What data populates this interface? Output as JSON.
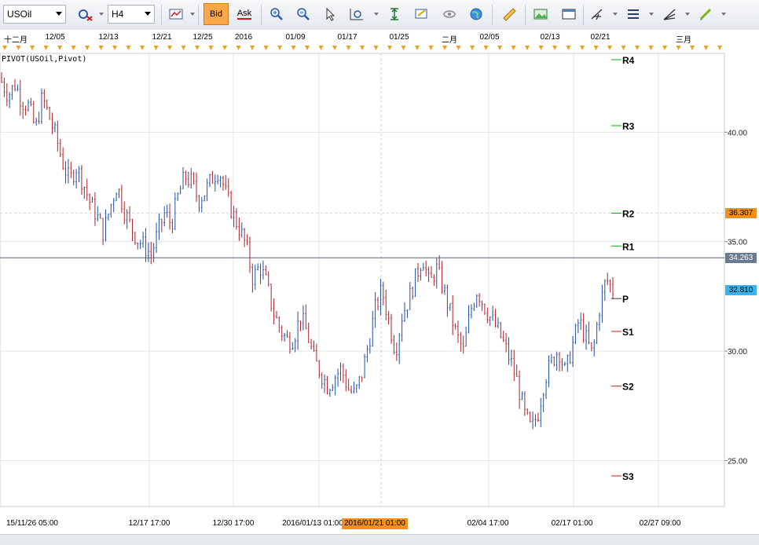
{
  "toolbar": {
    "symbol": "USOil",
    "timeframe": "H4",
    "bid_label": "Bid",
    "ask_label": "Ask"
  },
  "top_axis_labels": [
    "十二月",
    "12/05",
    "12/13",
    "12/21",
    "12/25",
    "2016",
    "01/09",
    "01/17",
    "01/25",
    "二月",
    "02/05",
    "02/13",
    "02/21",
    "三月"
  ],
  "bottom_axis_labels": [
    "15/11/26 05:00",
    "12/17 17:00",
    "12/30 17:00",
    "2016/01/13 01:00",
    "02/04 17:00",
    "02/17 01:00",
    "02/27 09:00"
  ],
  "highlighted_time": "2016/01/21 01:00",
  "indicator_label": "PIVOT(USOil,Pivot)",
  "chart_data": {
    "type": "candlestick",
    "symbol": "USOil",
    "timeframe": "H4",
    "y_ticks": [
      "40.00",
      "35.00",
      "30.00",
      "25.00"
    ],
    "ylim": [
      22.9,
      43.6
    ],
    "pivots": [
      {
        "name": "R4",
        "value": 44.0,
        "color": "#00b000"
      },
      {
        "name": "R3",
        "value": 40.3,
        "color": "#00b000"
      },
      {
        "name": "R2",
        "value": 36.3,
        "color": "#00b000"
      },
      {
        "name": "R1",
        "value": 34.8,
        "color": "#00b000"
      },
      {
        "name": "P",
        "value": 32.4,
        "color": "#333333"
      },
      {
        "name": "S1",
        "value": 30.9,
        "color": "#d01818"
      },
      {
        "name": "S2",
        "value": 28.4,
        "color": "#d01818"
      },
      {
        "name": "S3",
        "value": 24.3,
        "color": "#d01818"
      }
    ],
    "price_tags": [
      {
        "label": "36.307",
        "value": 36.307,
        "bg": "#f0911e",
        "fg": "#000000"
      },
      {
        "label": "34.263",
        "value": 34.263,
        "bg": "#6c7a8f",
        "fg": "#ffffff"
      },
      {
        "label": "32.810",
        "value": 32.81,
        "bg": "#3ab4ee",
        "fg": "#000000"
      }
    ],
    "current_price": 34.263,
    "bid_line": 36.307,
    "path": [
      42.3,
      41.7,
      42.2,
      41.4,
      41.2,
      40.1,
      41.6,
      40.7,
      39.8,
      38.6,
      37.8,
      38.4,
      37.7,
      36.8,
      36.2,
      35.4,
      36.6,
      37.6,
      36.5,
      35.7,
      35.1,
      34.8,
      34.4,
      35.4,
      36.3,
      35.8,
      37.1,
      38.0,
      37.7,
      36.9,
      37.3,
      37.9,
      38.3,
      37.2,
      36.3,
      35.6,
      34.8,
      33.3,
      33.9,
      33.1,
      31.8,
      31.0,
      30.5,
      30.6,
      31.6,
      30.8,
      29.6,
      29.0,
      28.4,
      28.8,
      29.2,
      28.3,
      28.0,
      28.9,
      30.3,
      31.9,
      32.8,
      31.4,
      30.0,
      31.7,
      32.4,
      33.4,
      34.3,
      33.0,
      33.8,
      32.9,
      31.8,
      30.7,
      30.0,
      31.8,
      32.8,
      32.1,
      31.5,
      31.0,
      30.3,
      29.5,
      28.5,
      27.1,
      26.4,
      27.2,
      28.8,
      29.5,
      30.1,
      29.0,
      30.2,
      31.4,
      30.6,
      29.8,
      31.9,
      33.3,
      32.8
    ],
    "price_range": [
      26.0,
      43.0
    ]
  }
}
